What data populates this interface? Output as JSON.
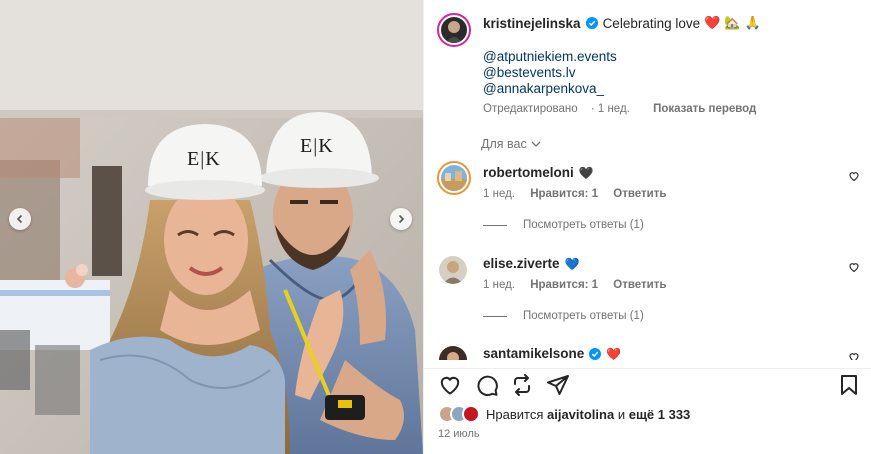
{
  "post": {
    "author": "kristinejelinska",
    "caption": "Celebrating love",
    "caption_emojis": [
      "❤️",
      "🏡",
      "🙏"
    ],
    "mentions": [
      "@atputniekiem.events",
      "@bestevents.lv",
      "@annakarpenkova_"
    ],
    "edited_label": "Отредактировано",
    "time_ago": "1 нед.",
    "translate_label": "Показать перевод",
    "helmet_text": "E|K",
    "date": "12 июль"
  },
  "comments_filter": {
    "label": "Для вас"
  },
  "comments": [
    {
      "username": "robertomeloni",
      "emoji": "🖤",
      "time": "1 нед.",
      "likes": "Нравится: 1",
      "reply": "Ответить",
      "view_replies": "Посмотреть ответы (1)"
    },
    {
      "username": "elise.ziverte",
      "emoji": "💙",
      "time": "1 нед.",
      "likes": "Нравится: 1",
      "reply": "Ответить",
      "view_replies": "Посмотреть ответы (1)"
    },
    {
      "username": "santamikelsone",
      "emoji": "❤️"
    }
  ],
  "likes": {
    "prefix": "Нравится",
    "user": "aijavitolina",
    "joiner": "и",
    "rest": "ещё 1 333"
  },
  "icons": {
    "like": "heart-icon",
    "comment": "comment-icon",
    "share": "repost-icon",
    "send": "send-icon",
    "save": "bookmark-icon"
  },
  "colors": {
    "link": "#00376b",
    "verified": "#0095f6",
    "meta": "#737373",
    "story_ring": "#d6249f"
  }
}
